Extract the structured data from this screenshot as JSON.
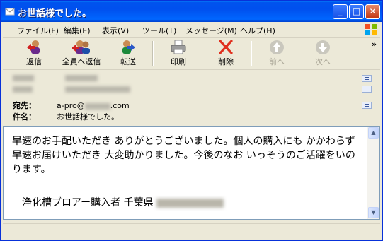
{
  "window": {
    "title": "お世話様でした。"
  },
  "menu": [
    {
      "label": "ファイル(F)"
    },
    {
      "label": "編集(E)"
    },
    {
      "label": "表示(V)"
    },
    {
      "label": "ツール(T)"
    },
    {
      "label": "メッセージ(M)"
    },
    {
      "label": "ヘルプ(H)"
    }
  ],
  "toolbar": {
    "reply": "返信",
    "reply_all": "全員へ返信",
    "forward": "転送",
    "print": "印刷",
    "delete": "削除",
    "previous": "前へ",
    "next": "次へ",
    "overflow": "»"
  },
  "header": {
    "to_label": "宛先：",
    "to_prefix": "a-pro@",
    "to_suffix": ".com",
    "subject_label": "件名：",
    "subject": "お世話様でした。"
  },
  "message": {
    "body": "早速のお手配いただき ありがとうございました。個人の購入にも かかわらず 早速お届けいただき 大変助かりました。今後のなお いっそうのご活躍をいのります。",
    "signature": "浄化槽ブロアー購入者 千葉県"
  },
  "colors": {
    "titlebar": "#0053ee",
    "delete_red": "#e0301e",
    "disabled_gray": "#aca899"
  }
}
